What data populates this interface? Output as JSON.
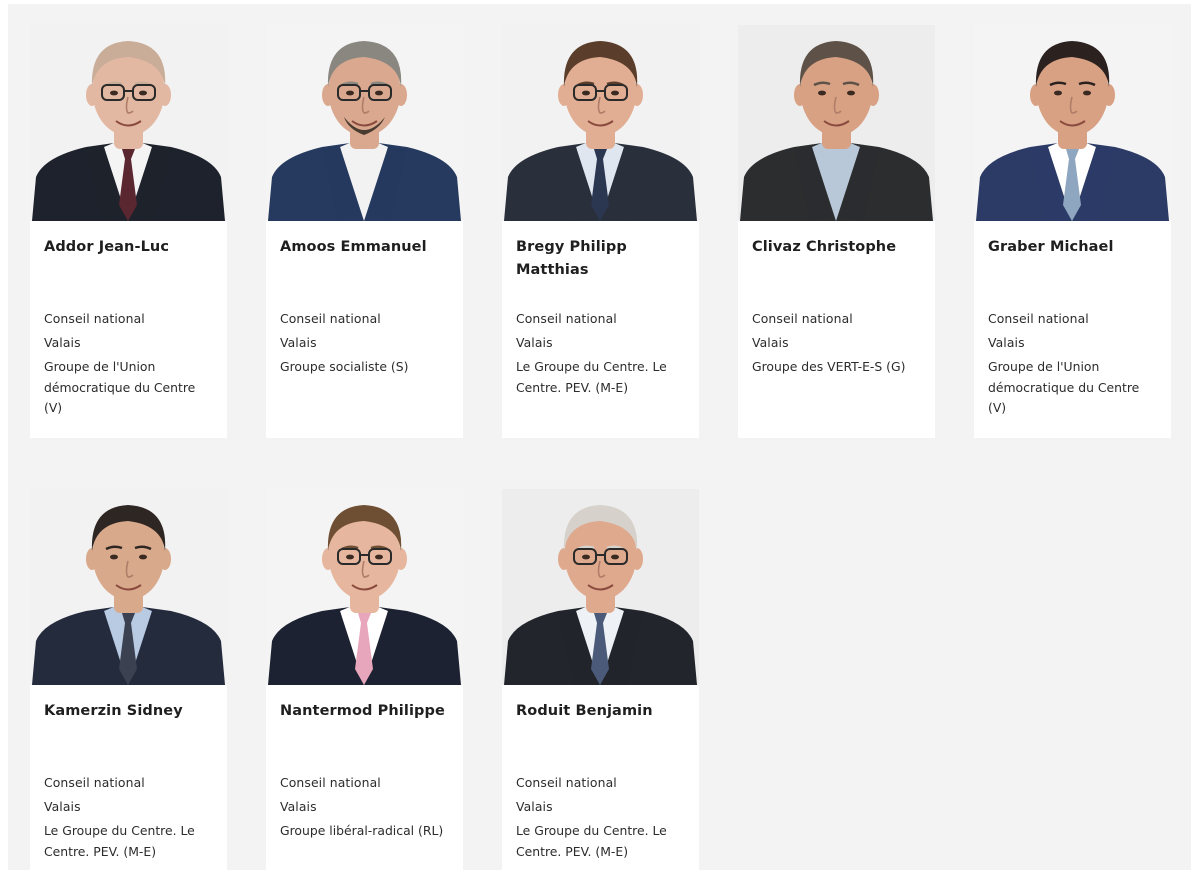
{
  "members": [
    {
      "name": "Addor Jean-Luc",
      "council": "Conseil national",
      "canton": "Valais",
      "group": "Groupe de l'Union démocratique du Centre (V)",
      "photo": {
        "bg": "#f2f2f2",
        "jacket": "#1e222c",
        "shirt": "#f4f4f4",
        "tie": "#5a2630",
        "skin": "#e3b8a2",
        "hair": "#c9ad98",
        "glasses": true,
        "beard": false
      }
    },
    {
      "name": "Amoos Emmanuel",
      "council": "Conseil national",
      "canton": "Valais",
      "group": "Groupe socialiste (S)",
      "photo": {
        "bg": "#f4f4f4",
        "jacket": "#26395f",
        "shirt": "#f2f2f2",
        "tie": "",
        "skin": "#d9a88e",
        "hair": "#8a8680",
        "glasses": true,
        "beard": true
      }
    },
    {
      "name": "Bregy Philipp Matthias",
      "council": "Conseil national",
      "canton": "Valais",
      "group": "Le Groupe du Centre. Le Centre. PEV. (M-E)",
      "photo": {
        "bg": "#f2f2f2",
        "jacket": "#2a2f3c",
        "shirt": "#dfe6ef",
        "tie": "#2b3650",
        "skin": "#e2ae93",
        "hair": "#5a3d2a",
        "glasses": true,
        "beard": false
      }
    },
    {
      "name": "Clivaz Christophe",
      "council": "Conseil national",
      "canton": "Valais",
      "group": "Groupe des VERT-E-S (G)",
      "photo": {
        "bg": "#ededed",
        "jacket": "#2c2d2f",
        "shirt": "#b9c8d9",
        "tie": "",
        "skin": "#d8a184",
        "hair": "#5e5248",
        "glasses": false,
        "beard": false
      }
    },
    {
      "name": "Graber Michael",
      "council": "Conseil national",
      "canton": "Valais",
      "group": "Groupe de l'Union démocratique du Centre (V)",
      "photo": {
        "bg": "#f4f4f4",
        "jacket": "#2c3b66",
        "shirt": "#ffffff",
        "tie": "#8fa6c0",
        "skin": "#d8a184",
        "hair": "#2b2220",
        "glasses": false,
        "beard": false
      }
    },
    {
      "name": "Kamerzin Sidney",
      "council": "Conseil national",
      "canton": "Valais",
      "group": "Le Groupe du Centre. Le Centre. PEV. (M-E)",
      "photo": {
        "bg": "#f2f2f2",
        "jacket": "#242b3d",
        "shirt": "#b8cbe3",
        "tie": "#3b4150",
        "skin": "#d9a98c",
        "hair": "#2e2622",
        "glasses": false,
        "beard": false
      }
    },
    {
      "name": "Nantermod Philippe",
      "council": "Conseil national",
      "canton": "Valais",
      "group": "Groupe libéral-radical (RL)",
      "photo": {
        "bg": "#f4f4f4",
        "jacket": "#1d2232",
        "shirt": "#ffffff",
        "tie": "#e8a6bd",
        "skin": "#e6b79e",
        "hair": "#6f4f33",
        "glasses": true,
        "beard": false
      }
    },
    {
      "name": "Roduit Benjamin",
      "council": "Conseil national",
      "canton": "Valais",
      "group": "Le Groupe du Centre. Le Centre. PEV. (M-E)",
      "photo": {
        "bg": "#ededed",
        "jacket": "#22252c",
        "shirt": "#eef1f6",
        "tie": "#4a5a78",
        "skin": "#dfa98e",
        "hair": "#d6d2cb",
        "glasses": true,
        "beard": false
      }
    }
  ]
}
